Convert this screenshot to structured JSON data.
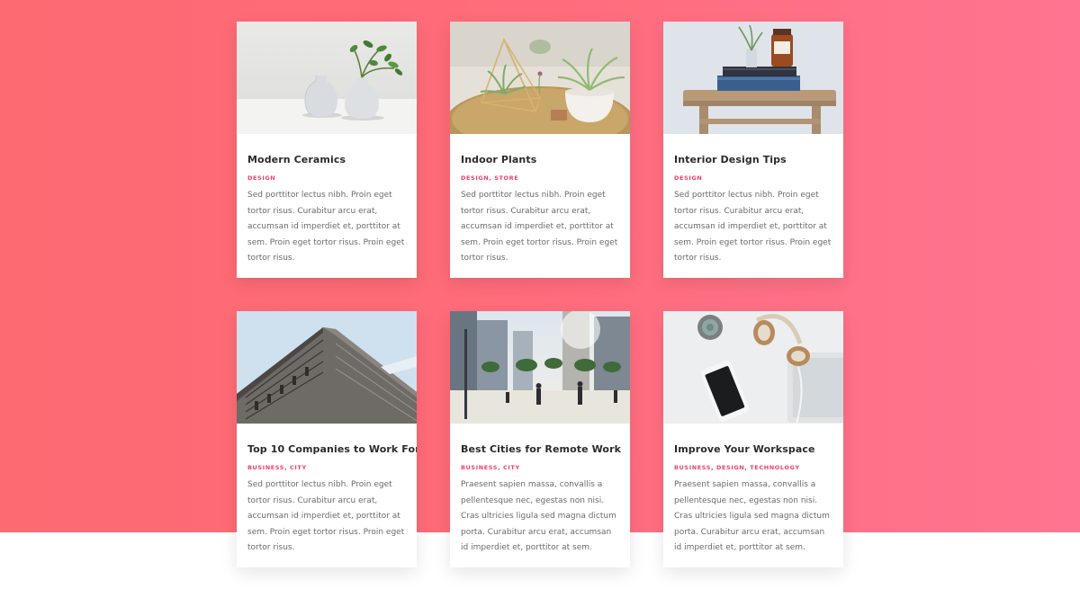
{
  "cards": [
    {
      "title": "Modern Ceramics",
      "categories": "DESIGN",
      "excerpt": "Sed porttitor lectus nibh. Proin eget tortor risus. Curabitur arcu erat, accumsan id imperdiet et, porttitor at sem. Proin eget tortor risus. Proin eget tortor risus.",
      "image": "ceramic-vases-photo"
    },
    {
      "title": "Indoor Plants",
      "categories": "DESIGN, STORE",
      "excerpt": "Sed porttitor lectus nibh. Proin eget tortor risus. Curabitur arcu erat, accumsan id imperdiet et, porttitor at sem. Proin eget tortor risus. Proin eget tortor risus.",
      "image": "air-plants-terrarium-photo"
    },
    {
      "title": "Interior Design Tips",
      "categories": "DESIGN",
      "excerpt": "Sed porttitor lectus nibh. Proin eget tortor risus. Curabitur arcu erat, accumsan id imperdiet et, porttitor at sem. Proin eget tortor risus. Proin eget tortor risus.",
      "image": "books-on-stool-photo"
    },
    {
      "title": "Top 10 Companies to Work For",
      "categories": "BUSINESS, CITY",
      "excerpt": "Sed porttitor lectus nibh. Proin eget tortor risus. Curabitur arcu erat, accumsan id imperdiet et, porttitor at sem. Proin eget tortor risus. Proin eget tortor risus.",
      "image": "office-building-photo"
    },
    {
      "title": "Best Cities for Remote Work",
      "categories": "BUSINESS, CITY",
      "excerpt": "Praesent sapien massa, convallis a pellentesque nec, egestas non nisi. Cras ultricies ligula sed magna dictum porta. Curabitur arcu erat, accumsan id imperdiet et, porttitor at sem.",
      "image": "city-street-photo"
    },
    {
      "title": "Improve Your Workspace",
      "categories": "BUSINESS, DESIGN, TECHNOLOGY",
      "excerpt": "Praesent sapien massa, convallis a pellentesque nec, egestas non nisi. Cras ultricies ligula sed magna dictum porta. Curabitur arcu erat, accumsan id imperdiet et, porttitor at sem.",
      "image": "desk-headphones-phone-photo"
    }
  ],
  "colors": {
    "gradient_start": "#fe6a72",
    "gradient_end": "#ff7490",
    "category_accent": "#ef3f6a",
    "title_text": "#2b2b2b",
    "body_text": "#6a6a6a"
  }
}
